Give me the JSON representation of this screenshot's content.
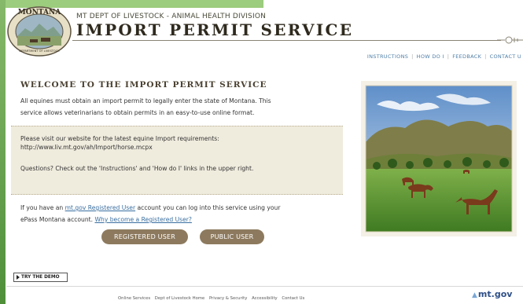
{
  "header": {
    "seal_text_top": "MONTANA",
    "seal_text_bottom": "DEPARTMENT OF LIVESTOCK",
    "subtitle": "MT DEPT OF LIVESTOCK - ANIMAL HEALTH DIVISION",
    "title": "IMPORT PERMIT SERVICE"
  },
  "nav": {
    "items": [
      "INSTRUCTIONS",
      "HOW DO I",
      "FEEDBACK",
      "CONTACT U"
    ]
  },
  "main": {
    "welcome_heading": "WELCOME TO THE IMPORT PERMIT SERVICE",
    "intro_line1": "All equines must obtain an import permit to legally enter the state of Montana. This",
    "intro_line2": "service allows veterinarians to obtain permits in an easy-to-use online format.",
    "info": {
      "line1": "Please visit our website for the latest equine Import requirements:",
      "url": "http://www.liv.mt.gov/ah/Import/horse.mcpx",
      "questions": "Questions?  Check out the 'Instructions' and 'How do I' links in the upper right."
    },
    "login": {
      "pre": "If you have an ",
      "link1": "mt.gov Registered User",
      "mid": " account you can log into this service using your",
      "line2_pre": "ePass Montana account. ",
      "link2": "Why become a Registered User?"
    },
    "buttons": {
      "registered": "REGISTERED USER",
      "public": "PUBLIC USER"
    }
  },
  "demo_button": "TRY THE DEMO",
  "footer": {
    "links": [
      "Online Services",
      "Dept of Livestock Home",
      "Privacy & Security",
      "Accessibility",
      "Contact Us"
    ],
    "brand": "mt.gov"
  },
  "colors": {
    "button": "#8d7a5e",
    "link": "#3a6fa0",
    "infobox": "#efebdd",
    "left_bar": "#4f8f3a"
  }
}
